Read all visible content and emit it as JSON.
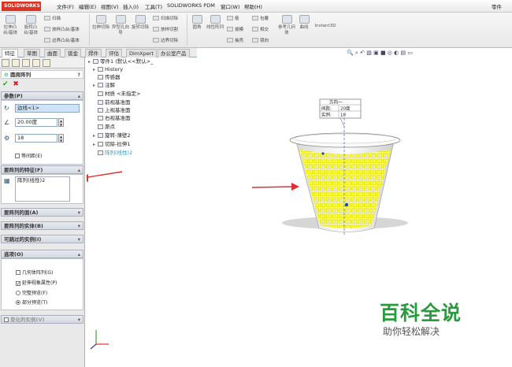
{
  "app": {
    "logo": "SOLIDWORKS",
    "doc_label": "零件"
  },
  "menu": [
    "文件(F)",
    "编辑(E)",
    "视图(V)",
    "插入(I)",
    "工具(T)",
    "SOLIDWORKS PDM",
    "窗口(W)",
    "帮助(H)"
  ],
  "ribbon": {
    "big": [
      "拉伸凸台/基体",
      "旋转凸台/基体",
      "拉伸切除",
      "异型孔向导",
      "旋转切除",
      "圆角",
      "线性阵列",
      "参考几何体",
      "曲线",
      "Instant3D"
    ],
    "small": [
      "扫描",
      "放样凸台/基体",
      "边界凸台/基体",
      "扫描切除",
      "放样切割",
      "边界切除",
      "筋",
      "拔模",
      "抽壳",
      "包覆",
      "相交",
      "镜向"
    ]
  },
  "tabs": [
    "特征",
    "草图",
    "曲面",
    "钣金",
    "焊件",
    "评估",
    "DimXpert",
    "办公室产品"
  ],
  "panel": {
    "title": "圆周阵列",
    "params_header": "参数(P)",
    "axis_value": "边线<1>",
    "angle_value": "20.00度",
    "count_value": "18",
    "equal_spacing": "等间距(E)",
    "features_header": "要阵列的特征(F)",
    "feature_item": "阵列(线性)2",
    "faces_header": "要阵列的面(A)",
    "bodies_header": "要阵列的实体(B)",
    "skip_header": "可跳过的实例(I)",
    "options_header": "选项(O)",
    "opt_geometry": "几何体阵列(G)",
    "opt_propagate": "延伸视象属性(P)",
    "opt_full_preview": "完整预览(F)",
    "opt_partial_preview": "部分预览(T)",
    "variable_header": "变化的实例(V)"
  },
  "tree": [
    {
      "label": "零件1 (默认<<默认>_",
      "level": 0
    },
    {
      "label": "History",
      "level": 1
    },
    {
      "label": "传感器",
      "level": 1
    },
    {
      "label": "注解",
      "level": 1
    },
    {
      "label": "材质 <未指定>",
      "level": 1
    },
    {
      "label": "前视基准面",
      "level": 1
    },
    {
      "label": "上视基准面",
      "level": 1
    },
    {
      "label": "右视基准面",
      "level": 1
    },
    {
      "label": "原点",
      "level": 1
    },
    {
      "label": "旋转-薄壁2",
      "level": 1
    },
    {
      "label": "切除-拉伸1",
      "level": 1
    },
    {
      "label": "阵列(线性)2",
      "level": 1
    }
  ],
  "callout": {
    "title": "方向一",
    "spacing_label": "间距:",
    "spacing_value": "20度",
    "count_label": "实例:",
    "count_value": "18"
  },
  "watermark": {
    "title": "百科全说",
    "subtitle": "助你轻松解决"
  },
  "colors": {
    "pattern_yellow": "#f0f000",
    "arrow_red": "#e03030",
    "watermark_green": "#2a9a3e"
  }
}
